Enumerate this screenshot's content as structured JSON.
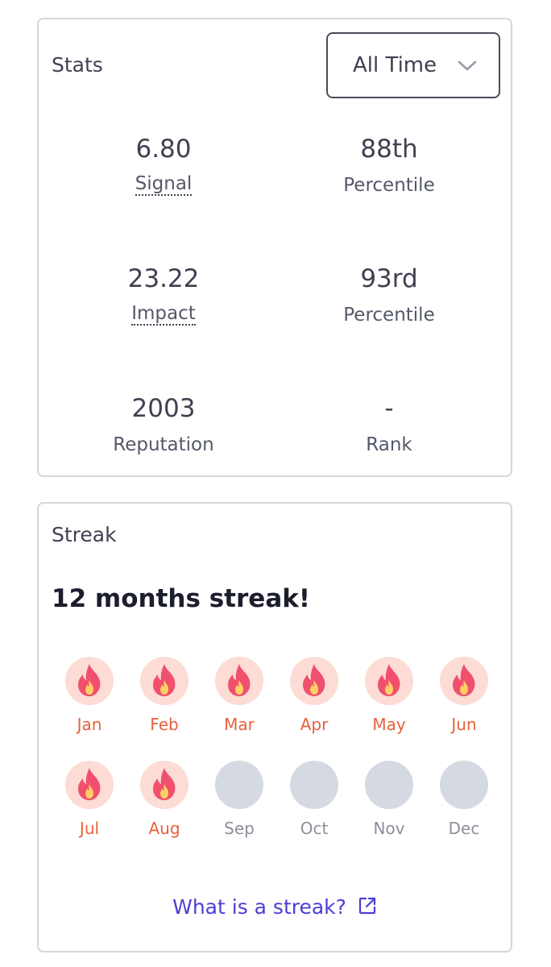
{
  "stats": {
    "title": "Stats",
    "filter": {
      "selected": "All Time",
      "icon": "chevron-down-icon"
    },
    "items": [
      {
        "value": "6.80",
        "label": "Signal",
        "dotted": true
      },
      {
        "value": "88th",
        "label": "Percentile",
        "dotted": false
      },
      {
        "value": "23.22",
        "label": "Impact",
        "dotted": true
      },
      {
        "value": "93rd",
        "label": "Percentile",
        "dotted": false
      },
      {
        "value": "2003",
        "label": "Reputation",
        "dotted": false
      },
      {
        "value": "-",
        "label": "Rank",
        "dotted": false
      }
    ]
  },
  "streak": {
    "title": "Streak",
    "heading": "12 months streak!",
    "months": [
      {
        "label": "Jan",
        "active": true
      },
      {
        "label": "Feb",
        "active": true
      },
      {
        "label": "Mar",
        "active": true
      },
      {
        "label": "Apr",
        "active": true
      },
      {
        "label": "May",
        "active": true
      },
      {
        "label": "Jun",
        "active": true
      },
      {
        "label": "Jul",
        "active": true
      },
      {
        "label": "Aug",
        "active": true
      },
      {
        "label": "Sep",
        "active": false
      },
      {
        "label": "Oct",
        "active": false
      },
      {
        "label": "Nov",
        "active": false
      },
      {
        "label": "Dec",
        "active": false
      }
    ],
    "link_label": "What is a streak?",
    "link_icon": "external-link-icon"
  },
  "colors": {
    "accent": "#4b3fd6",
    "active_month_text": "#e8603c",
    "active_month_bg": "#fcdcd4",
    "inactive_month_bg": "#d5d9e1",
    "flame_outer": "#f0506e",
    "flame_inner": "#fdd066"
  }
}
